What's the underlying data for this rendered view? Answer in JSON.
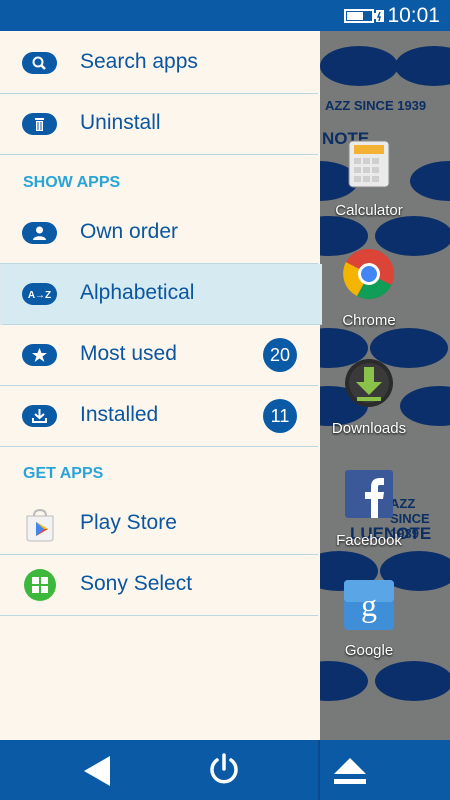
{
  "status": {
    "time": "10:01",
    "battery_icon": "battery-charging-icon"
  },
  "drawer": {
    "items": [
      {
        "label": "Search apps",
        "icon": "search-icon"
      },
      {
        "label": "Uninstall",
        "icon": "trash-icon"
      }
    ],
    "show_apps_header": "SHOW APPS",
    "show_apps": [
      {
        "label": "Own order",
        "icon": "person-icon"
      },
      {
        "label": "Alphabetical",
        "icon": "a-z-icon",
        "selected": true
      },
      {
        "label": "Most used",
        "icon": "star-icon",
        "badge": "20"
      },
      {
        "label": "Installed",
        "icon": "download-icon",
        "badge": "11"
      }
    ],
    "get_apps_header": "GET APPS",
    "get_apps": [
      {
        "label": "Play Store",
        "icon": "play-store-icon"
      },
      {
        "label": "Sony Select",
        "icon": "sony-select-icon"
      }
    ]
  },
  "desktop": {
    "apps": [
      {
        "label": "Calculator",
        "icon": "calculator-icon"
      },
      {
        "label": "Chrome",
        "icon": "chrome-icon"
      },
      {
        "label": "Downloads",
        "icon": "downloads-icon"
      },
      {
        "label": "Facebook",
        "icon": "facebook-icon"
      },
      {
        "label": "Google",
        "icon": "google-icon"
      }
    ],
    "wallpaper_text_1": "AZZ SINCE 1939",
    "wallpaper_text_2": "NOTE",
    "wallpaper_text_3": "AZZ SINCE 1939",
    "wallpaper_text_4": "LUENOTE"
  },
  "navbar": {
    "back_icon": "back-icon",
    "power_icon": "power-icon",
    "eject_icon": "eject-icon"
  },
  "colors": {
    "accent": "#0b5aa6",
    "section": "#29a4d6",
    "drawer_bg": "#fdf6ed",
    "selected_bg": "#d6eaf1"
  }
}
